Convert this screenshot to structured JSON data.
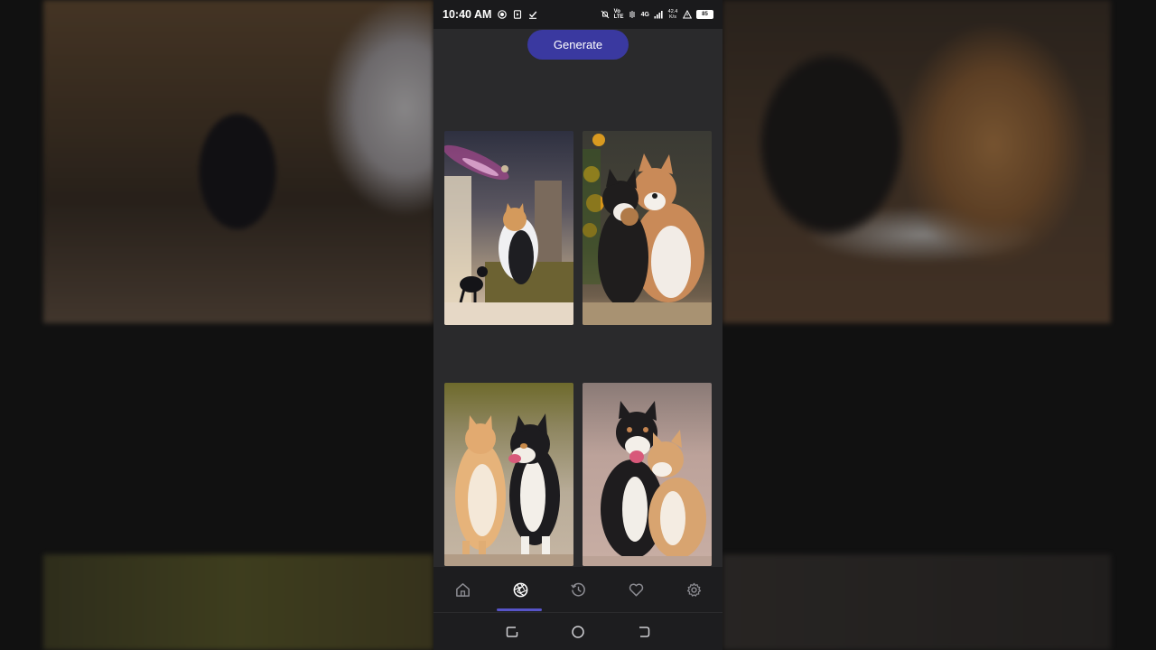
{
  "status_bar": {
    "time": "10:40 AM",
    "network_badge": "Vo LTE",
    "signal_label": "4G",
    "speed": "42.4 K/s",
    "battery": "85"
  },
  "main": {
    "generate_label": "Generate"
  },
  "gallery": {
    "images": [
      {
        "subject": "cat-and-black-cat-under-galaxy-window"
      },
      {
        "subject": "akita-dog-hugging-kitten"
      },
      {
        "subject": "tabby-cat-with-husky-dog"
      },
      {
        "subject": "two-dogs-cuddling"
      }
    ]
  },
  "tabs": [
    {
      "id": "home",
      "icon": "home-icon",
      "active": false
    },
    {
      "id": "generate",
      "icon": "aperture-icon",
      "active": true
    },
    {
      "id": "history",
      "icon": "history-icon",
      "active": false
    },
    {
      "id": "favorites",
      "icon": "heart-icon",
      "active": false
    },
    {
      "id": "settings",
      "icon": "gear-icon",
      "active": false
    }
  ],
  "colors": {
    "accent": "#3a39a0",
    "indicator": "#5754c8",
    "surface": "#2a2a2c",
    "bar": "#1d1d1f"
  }
}
